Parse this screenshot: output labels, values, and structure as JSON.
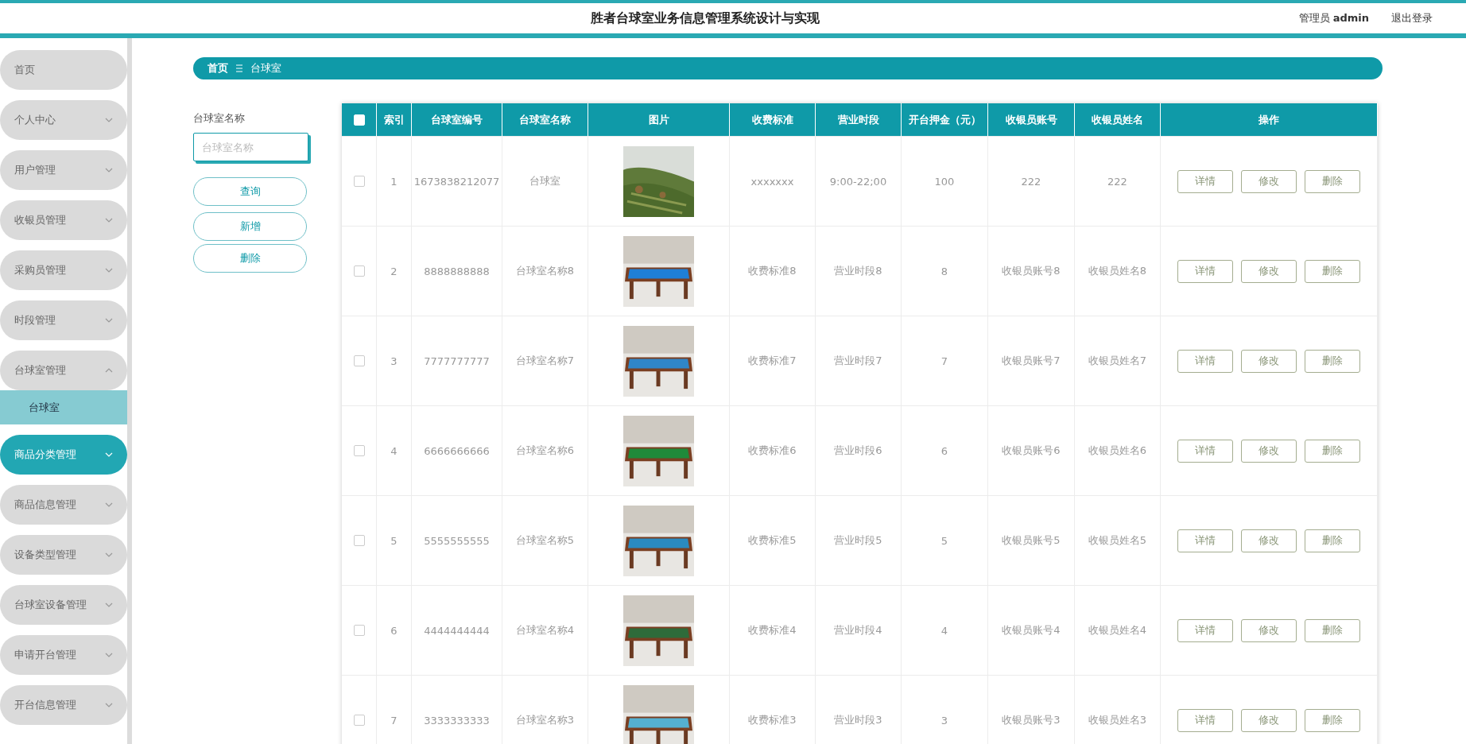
{
  "header": {
    "title": "胜者台球室业务信息管理系统设计与实现",
    "user": "管理员 **admin**",
    "logout": "退出登录"
  },
  "sidebar": {
    "items": [
      {
        "label": "首页",
        "selected": false
      },
      {
        "label": "个人中心",
        "selected": false,
        "expanded": false
      },
      {
        "label": "用户管理",
        "selected": false,
        "expanded": false
      },
      {
        "label": "收银员管理",
        "selected": false,
        "expanded": false
      },
      {
        "label": "采购员管理",
        "selected": false,
        "expanded": false
      },
      {
        "label": "时段管理",
        "selected": false,
        "expanded": false
      },
      {
        "label": "台球室管理",
        "selected": false,
        "expanded": true,
        "children": [
          {
            "label": "台球室",
            "selected": true
          }
        ]
      },
      {
        "label": "商品分类管理",
        "selected": true,
        "expanded": false
      },
      {
        "label": "商品信息管理",
        "selected": false,
        "expanded": false
      },
      {
        "label": "设备类型管理",
        "selected": false,
        "expanded": false
      },
      {
        "label": "台球室设备管理",
        "selected": false,
        "expanded": false
      },
      {
        "label": "申请开台管理",
        "selected": false,
        "expanded": false
      },
      {
        "label": "开台信息管理",
        "selected": false,
        "expanded": false
      }
    ]
  },
  "breadcrumb": [
    "首页",
    "台球室"
  ],
  "search": {
    "label": "台球室名称",
    "placeholder": "台球室名称",
    "buttons": [
      "查询",
      "新增",
      "删除"
    ]
  },
  "table": {
    "select_all": {
      "checked": false
    },
    "columns": [
      "索引",
      "台球室编号",
      "台球室名称",
      "图片",
      "收费标准",
      "营业时段",
      "开台押金（元）",
      "收银员账号",
      "收银员姓名",
      "操作"
    ],
    "rows": [
      {
        "checked": false,
        "cells": [
          "1",
          "1673838212077",
          "台球室"
        ],
        "more": [
          "xxxxxxx",
          "9:00-22;00",
          "100",
          "222",
          "222"
        ],
        "actions": [
          "详情",
          "修改",
          "删除"
        ]
      },
      {
        "checked": false,
        "cells": [
          "2",
          "8888888888",
          "台球室名称8"
        ],
        "more": [
          "收费标准8",
          "营业时段8",
          "8",
          "收银员账号8",
          "收银员姓名8"
        ],
        "actions": [
          "详情",
          "修改",
          "删除"
        ]
      },
      {
        "checked": false,
        "cells": [
          "3",
          "7777777777",
          "台球室名称7"
        ],
        "more": [
          "收费标准7",
          "营业时段7",
          "7",
          "收银员账号7",
          "收银员姓名7"
        ],
        "actions": [
          "详情",
          "修改",
          "删除"
        ]
      },
      {
        "checked": false,
        "cells": [
          "4",
          "6666666666",
          "台球室名称6"
        ],
        "more": [
          "收费标准6",
          "营业时段6",
          "6",
          "收银员账号6",
          "收银员姓名6"
        ],
        "actions": [
          "详情",
          "修改",
          "删除"
        ]
      },
      {
        "checked": false,
        "cells": [
          "5",
          "5555555555",
          "台球室名称5"
        ],
        "more": [
          "收费标准5",
          "营业时段5",
          "5",
          "收银员账号5",
          "收银员姓名5"
        ],
        "actions": [
          "详情",
          "修改",
          "删除"
        ]
      },
      {
        "checked": false,
        "cells": [
          "6",
          "4444444444",
          "台球室名称4"
        ],
        "more": [
          "收费标准4",
          "营业时段4",
          "4",
          "收银员账号4",
          "收银员姓名4"
        ],
        "actions": [
          "详情",
          "修改",
          "删除"
        ]
      },
      {
        "checked": false,
        "cells": [
          "7",
          "3333333333",
          "台球室名称3"
        ],
        "more": [
          "收费标准3",
          "营业时段3",
          "3",
          "收银员账号3",
          "收银员姓名3"
        ],
        "actions": [
          "详情",
          "修改",
          "删除"
        ]
      }
    ]
  }
}
